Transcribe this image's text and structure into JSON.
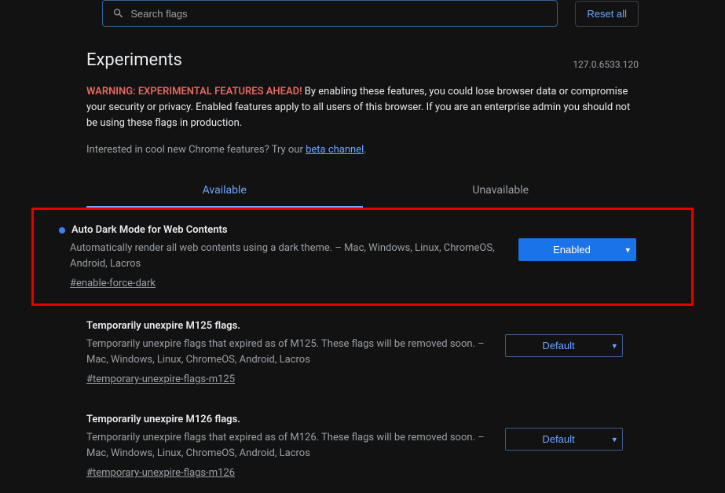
{
  "search": {
    "placeholder": "Search flags"
  },
  "reset_label": "Reset all",
  "title": "Experiments",
  "version": "127.0.6533.120",
  "warning": {
    "prefix": "WARNING: EXPERIMENTAL FEATURES AHEAD!",
    "body": " By enabling these features, you could lose browser data or compromise your security or privacy. Enabled features apply to all users of this browser. If you are an enterprise admin you should not be using these flags in production."
  },
  "beta": {
    "prefix": "Interested in cool new Chrome features? Try our ",
    "link_text": "beta channel",
    "suffix": "."
  },
  "tabs": {
    "available": "Available",
    "unavailable": "Unavailable"
  },
  "flags": [
    {
      "title": "Auto Dark Mode for Web Contents",
      "desc": "Automatically render all web contents using a dark theme. – Mac, Windows, Linux, ChromeOS, Android, Lacros",
      "hash": "#enable-force-dark",
      "value": "Enabled",
      "highlighted": true,
      "dot": true
    },
    {
      "title": "Temporarily unexpire M125 flags.",
      "desc": "Temporarily unexpire flags that expired as of M125. These flags will be removed soon. – Mac, Windows, Linux, ChromeOS, Android, Lacros",
      "hash": "#temporary-unexpire-flags-m125",
      "value": "Default",
      "highlighted": false,
      "dot": false
    },
    {
      "title": "Temporarily unexpire M126 flags.",
      "desc": "Temporarily unexpire flags that expired as of M126. These flags will be removed soon. – Mac, Windows, Linux, ChromeOS, Android, Lacros",
      "hash": "#temporary-unexpire-flags-m126",
      "value": "Default",
      "highlighted": false,
      "dot": false
    }
  ]
}
